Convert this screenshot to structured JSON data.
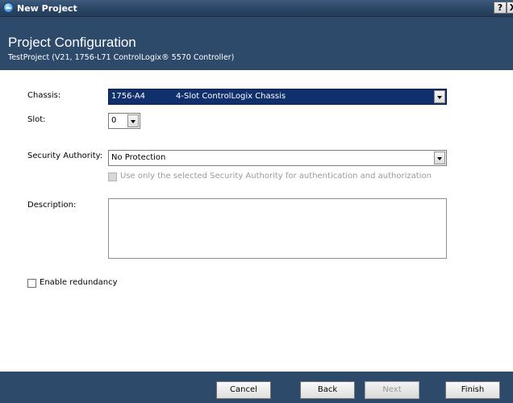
{
  "window": {
    "title": "New Project",
    "help_label": "?",
    "close_label": "X"
  },
  "header": {
    "title": "Project Configuration",
    "subtitle": "TestProject (V21, 1756-L71 ControlLogix® 5570 Controller)"
  },
  "form": {
    "chassis": {
      "label": "Chassis:",
      "value": "1756-A4",
      "value_desc": "4-Slot ControlLogix Chassis"
    },
    "slot": {
      "label": "Slot:",
      "value": "0"
    },
    "security_authority": {
      "label": "Security Authority:",
      "value": "No Protection",
      "use_only_label": "Use only the selected Security Authority for authentication and authorization"
    },
    "description": {
      "label": "Description:",
      "value": ""
    },
    "redundancy": {
      "label": "Enable redundancy"
    }
  },
  "buttons": {
    "cancel": "Cancel",
    "back": "Back",
    "next": "Next",
    "finish": "Finish"
  },
  "colors": {
    "header_bg": "#2e4a6b",
    "selection": "#10306d"
  }
}
